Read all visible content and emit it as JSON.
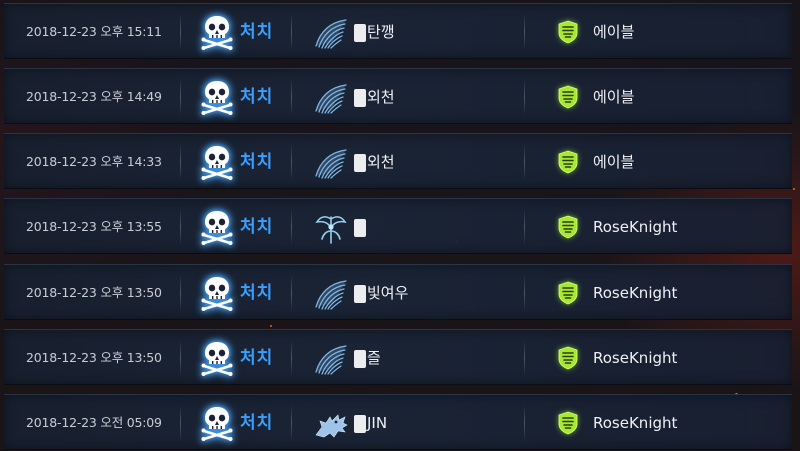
{
  "rows": [
    {
      "time": "2018-12-23 오후 15:11",
      "action": "처치",
      "class_icon": "wing-icon",
      "name_suffix": "탄깽",
      "guild": "에이블"
    },
    {
      "time": "2018-12-23 오후 14:49",
      "action": "처치",
      "class_icon": "wing-icon",
      "name_suffix": "외천",
      "guild": "에이블"
    },
    {
      "time": "2018-12-23 오후 14:33",
      "action": "처치",
      "class_icon": "wing-icon",
      "name_suffix": "외천",
      "guild": "에이블"
    },
    {
      "time": "2018-12-23 오후 13:55",
      "action": "처치",
      "class_icon": "staff-icon",
      "name_suffix": "",
      "guild": "RoseKnight"
    },
    {
      "time": "2018-12-23 오후 13:50",
      "action": "처치",
      "class_icon": "wing-icon",
      "name_suffix": "빛여우",
      "guild": "RoseKnight"
    },
    {
      "time": "2018-12-23 오후 13:50",
      "action": "처치",
      "class_icon": "wing-icon",
      "name_suffix": "즐",
      "guild": "RoseKnight"
    },
    {
      "time": "2018-12-23 오전 05:09",
      "action": "처치",
      "class_icon": "dragon-icon",
      "name_suffix": "JIN",
      "guild": "RoseKnight"
    }
  ],
  "colors": {
    "action": "#3aa0ff",
    "guild_emblem": "#a6e832",
    "text": "#eef0f4"
  }
}
